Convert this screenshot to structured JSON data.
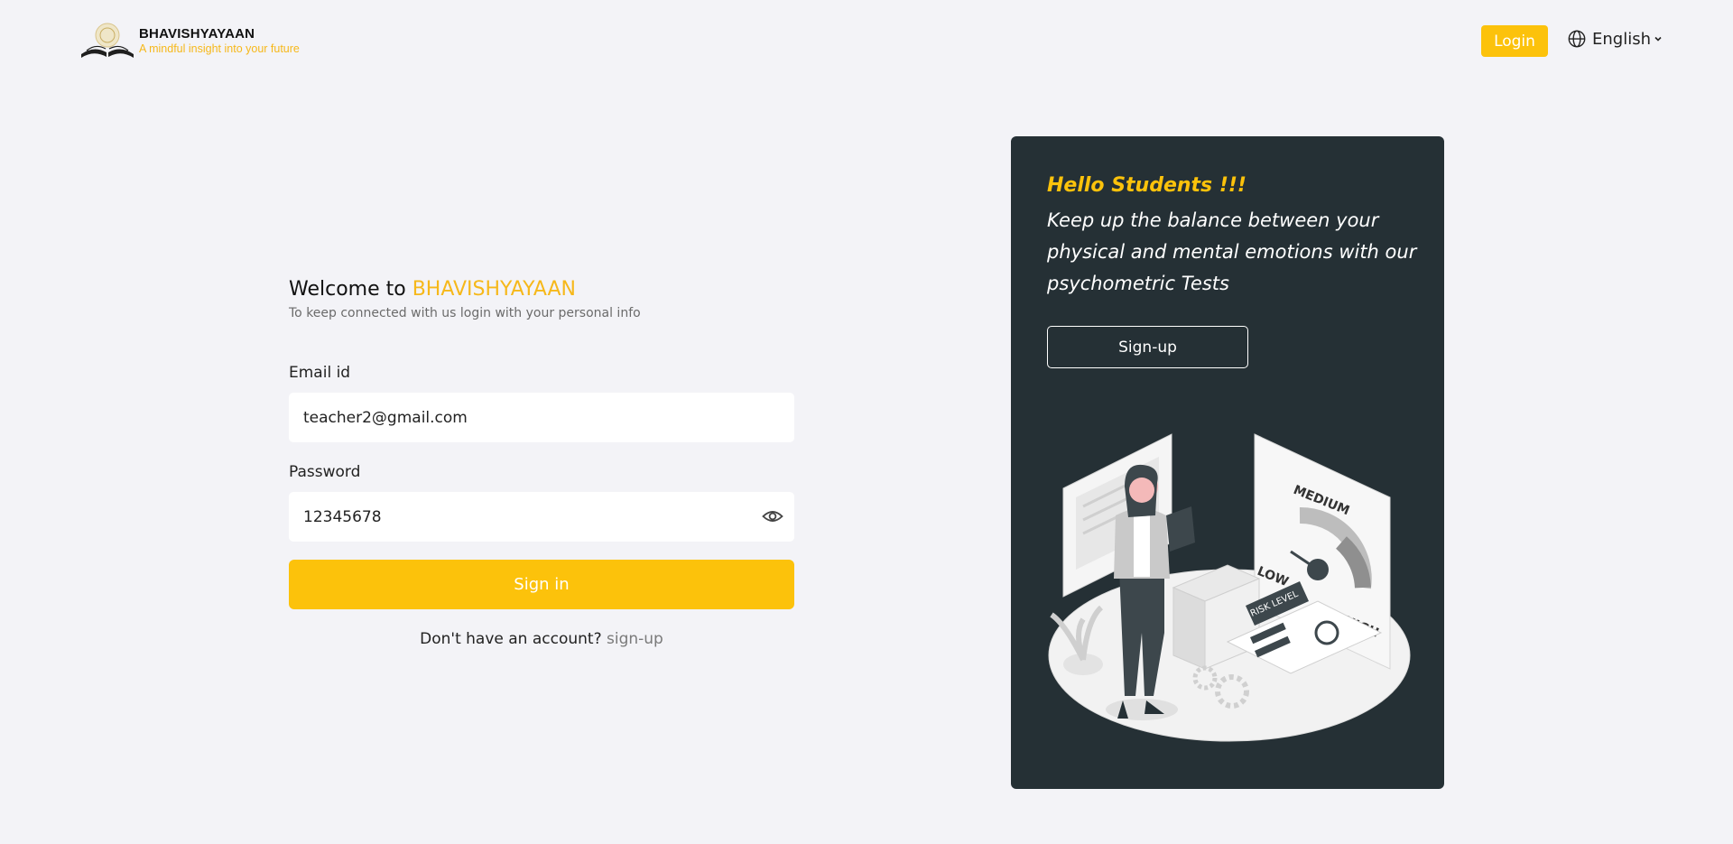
{
  "brand": {
    "name": "BHAVISHYAYAAN",
    "tagline": "A mindful insight into your future"
  },
  "header": {
    "login_label": "Login",
    "language": "English"
  },
  "login_form": {
    "welcome_prefix": "Welcome to ",
    "welcome_brand": "BHAVISHYAYAAN",
    "subtitle": "To keep connected with us login with your personal info",
    "email_label": "Email id",
    "email_value": "teacher2@gmail.com",
    "password_label": "Password",
    "password_value": "12345678",
    "signin_label": "Sign in",
    "no_account_text": "Don't have an account? ",
    "signup_link": "sign-up"
  },
  "promo_card": {
    "greeting": "Hello Students !!!",
    "message": "Keep up the balance between your physical and mental emotions with our psychometric Tests",
    "signup_label": "Sign-up",
    "illustration_labels": {
      "medium": "MEDIUM",
      "low": "LOW",
      "high": "HIGH",
      "risk_level": "RISK LEVEL"
    }
  },
  "colors": {
    "accent": "#fcc20b",
    "card_bg": "#253035",
    "page_bg": "#f3f3f7"
  },
  "icons": [
    "logo-icon",
    "globe-icon",
    "chevron-down-icon",
    "eye-icon"
  ]
}
